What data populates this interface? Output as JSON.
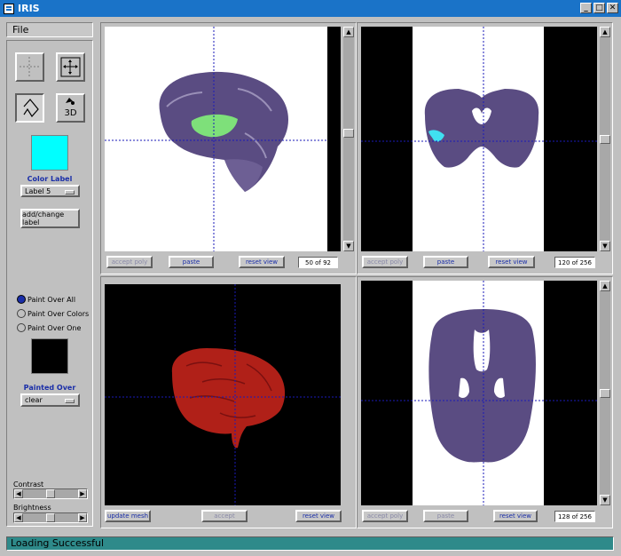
{
  "window": {
    "title": "IRIS",
    "controls": [
      "minimize-icon",
      "maximize-icon",
      "close-icon"
    ]
  },
  "menu": {
    "file": "File"
  },
  "toolbar": {
    "tools": [
      "crosshair-icon",
      "navigate-icon",
      "polygon-icon",
      "3d-paint-icon"
    ],
    "tool_3d_label": "3D",
    "color_label_caption": "Color Label",
    "color_label_value": "Label 5",
    "color_label_swatch": "#00ffff",
    "add_change_label": "add/change label",
    "paint_modes": [
      "Paint Over All",
      "Paint Over Colors",
      "Paint Over One"
    ],
    "paint_mode_selected": 0,
    "painted_over_caption": "Painted Over",
    "painted_over_value": "clear",
    "painted_over_swatch": "#000000",
    "contrast_label": "Contrast",
    "brightness_label": "Brightness",
    "contrast_level": 0.5,
    "brightness_level": 0.5
  },
  "views": {
    "sagittal": {
      "accept": "accept poly",
      "paste": "paste",
      "reset": "reset view",
      "slice": "50 of 92",
      "scroll_level": 0.47
    },
    "coronal": {
      "accept": "accept poly",
      "paste": "paste",
      "reset": "reset view",
      "slice": "120 of 256",
      "scroll_level": 0.5
    },
    "render3d": {
      "update": "update mesh",
      "accept": "accept",
      "reset": "reset view"
    },
    "axial": {
      "accept": "accept poly",
      "paste": "paste",
      "reset": "reset view",
      "slice": "128 of 256",
      "scroll_level": 0.5
    }
  },
  "colors": {
    "brain": "#5a4c82",
    "label": "#7ee07a",
    "mesh": "#b02018",
    "crosshair": "#1a1ab8",
    "status_bg": "#2e8a8a"
  },
  "status": {
    "text": "Loading Successful"
  }
}
